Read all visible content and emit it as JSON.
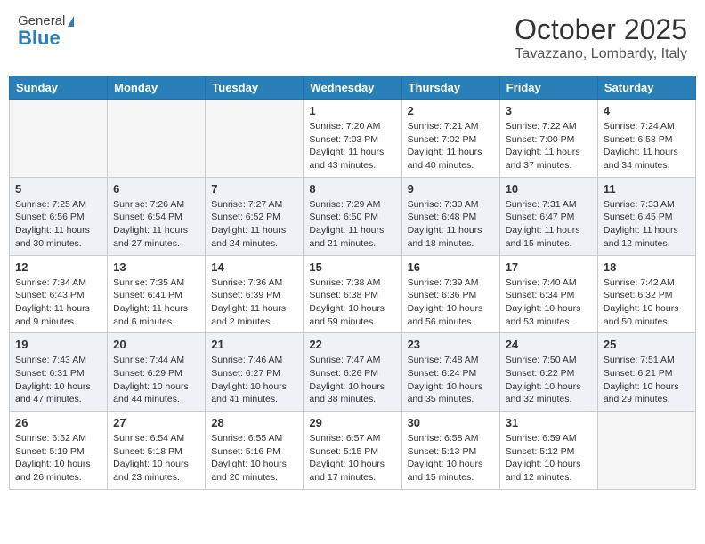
{
  "header": {
    "logo_general": "General",
    "logo_blue": "Blue",
    "month_title": "October 2025",
    "location": "Tavazzano, Lombardy, Italy"
  },
  "days_of_week": [
    "Sunday",
    "Monday",
    "Tuesday",
    "Wednesday",
    "Thursday",
    "Friday",
    "Saturday"
  ],
  "weeks": [
    {
      "shaded": false,
      "days": [
        {
          "number": "",
          "info": ""
        },
        {
          "number": "",
          "info": ""
        },
        {
          "number": "",
          "info": ""
        },
        {
          "number": "1",
          "info": "Sunrise: 7:20 AM\nSunset: 7:03 PM\nDaylight: 11 hours\nand 43 minutes."
        },
        {
          "number": "2",
          "info": "Sunrise: 7:21 AM\nSunset: 7:02 PM\nDaylight: 11 hours\nand 40 minutes."
        },
        {
          "number": "3",
          "info": "Sunrise: 7:22 AM\nSunset: 7:00 PM\nDaylight: 11 hours\nand 37 minutes."
        },
        {
          "number": "4",
          "info": "Sunrise: 7:24 AM\nSunset: 6:58 PM\nDaylight: 11 hours\nand 34 minutes."
        }
      ]
    },
    {
      "shaded": true,
      "days": [
        {
          "number": "5",
          "info": "Sunrise: 7:25 AM\nSunset: 6:56 PM\nDaylight: 11 hours\nand 30 minutes."
        },
        {
          "number": "6",
          "info": "Sunrise: 7:26 AM\nSunset: 6:54 PM\nDaylight: 11 hours\nand 27 minutes."
        },
        {
          "number": "7",
          "info": "Sunrise: 7:27 AM\nSunset: 6:52 PM\nDaylight: 11 hours\nand 24 minutes."
        },
        {
          "number": "8",
          "info": "Sunrise: 7:29 AM\nSunset: 6:50 PM\nDaylight: 11 hours\nand 21 minutes."
        },
        {
          "number": "9",
          "info": "Sunrise: 7:30 AM\nSunset: 6:48 PM\nDaylight: 11 hours\nand 18 minutes."
        },
        {
          "number": "10",
          "info": "Sunrise: 7:31 AM\nSunset: 6:47 PM\nDaylight: 11 hours\nand 15 minutes."
        },
        {
          "number": "11",
          "info": "Sunrise: 7:33 AM\nSunset: 6:45 PM\nDaylight: 11 hours\nand 12 minutes."
        }
      ]
    },
    {
      "shaded": false,
      "days": [
        {
          "number": "12",
          "info": "Sunrise: 7:34 AM\nSunset: 6:43 PM\nDaylight: 11 hours\nand 9 minutes."
        },
        {
          "number": "13",
          "info": "Sunrise: 7:35 AM\nSunset: 6:41 PM\nDaylight: 11 hours\nand 6 minutes."
        },
        {
          "number": "14",
          "info": "Sunrise: 7:36 AM\nSunset: 6:39 PM\nDaylight: 11 hours\nand 2 minutes."
        },
        {
          "number": "15",
          "info": "Sunrise: 7:38 AM\nSunset: 6:38 PM\nDaylight: 10 hours\nand 59 minutes."
        },
        {
          "number": "16",
          "info": "Sunrise: 7:39 AM\nSunset: 6:36 PM\nDaylight: 10 hours\nand 56 minutes."
        },
        {
          "number": "17",
          "info": "Sunrise: 7:40 AM\nSunset: 6:34 PM\nDaylight: 10 hours\nand 53 minutes."
        },
        {
          "number": "18",
          "info": "Sunrise: 7:42 AM\nSunset: 6:32 PM\nDaylight: 10 hours\nand 50 minutes."
        }
      ]
    },
    {
      "shaded": true,
      "days": [
        {
          "number": "19",
          "info": "Sunrise: 7:43 AM\nSunset: 6:31 PM\nDaylight: 10 hours\nand 47 minutes."
        },
        {
          "number": "20",
          "info": "Sunrise: 7:44 AM\nSunset: 6:29 PM\nDaylight: 10 hours\nand 44 minutes."
        },
        {
          "number": "21",
          "info": "Sunrise: 7:46 AM\nSunset: 6:27 PM\nDaylight: 10 hours\nand 41 minutes."
        },
        {
          "number": "22",
          "info": "Sunrise: 7:47 AM\nSunset: 6:26 PM\nDaylight: 10 hours\nand 38 minutes."
        },
        {
          "number": "23",
          "info": "Sunrise: 7:48 AM\nSunset: 6:24 PM\nDaylight: 10 hours\nand 35 minutes."
        },
        {
          "number": "24",
          "info": "Sunrise: 7:50 AM\nSunset: 6:22 PM\nDaylight: 10 hours\nand 32 minutes."
        },
        {
          "number": "25",
          "info": "Sunrise: 7:51 AM\nSunset: 6:21 PM\nDaylight: 10 hours\nand 29 minutes."
        }
      ]
    },
    {
      "shaded": false,
      "days": [
        {
          "number": "26",
          "info": "Sunrise: 6:52 AM\nSunset: 5:19 PM\nDaylight: 10 hours\nand 26 minutes."
        },
        {
          "number": "27",
          "info": "Sunrise: 6:54 AM\nSunset: 5:18 PM\nDaylight: 10 hours\nand 23 minutes."
        },
        {
          "number": "28",
          "info": "Sunrise: 6:55 AM\nSunset: 5:16 PM\nDaylight: 10 hours\nand 20 minutes."
        },
        {
          "number": "29",
          "info": "Sunrise: 6:57 AM\nSunset: 5:15 PM\nDaylight: 10 hours\nand 17 minutes."
        },
        {
          "number": "30",
          "info": "Sunrise: 6:58 AM\nSunset: 5:13 PM\nDaylight: 10 hours\nand 15 minutes."
        },
        {
          "number": "31",
          "info": "Sunrise: 6:59 AM\nSunset: 5:12 PM\nDaylight: 10 hours\nand 12 minutes."
        },
        {
          "number": "",
          "info": ""
        }
      ]
    }
  ]
}
